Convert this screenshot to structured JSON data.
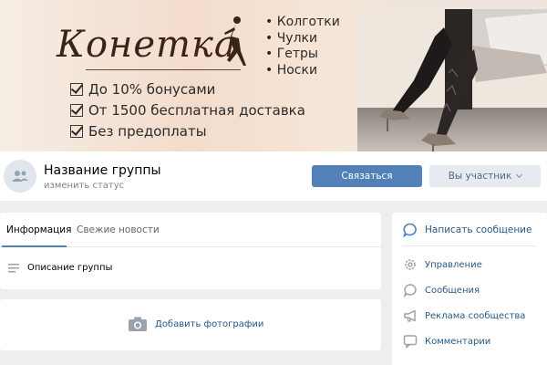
{
  "cover": {
    "logo": "Конетка",
    "features": [
      "• Колготки",
      "• Чулки",
      "• Гетры",
      "• Носки"
    ],
    "perks": [
      "До 10% бонусами",
      "От 1500 бесплатная доставка",
      "Без предоплаты"
    ]
  },
  "header": {
    "group_name": "Название группы",
    "status": "изменить статус",
    "contact_button": "Связаться",
    "member_button": "Вы участник"
  },
  "info_card": {
    "tabs": [
      {
        "label": "Информация",
        "active": true
      },
      {
        "label": "Свежие новости",
        "active": false
      }
    ],
    "description": "Описание группы"
  },
  "photo_card": {
    "add_photo": "Добавить фотографии"
  },
  "menu": {
    "send_message": "Написать сообщение",
    "items": [
      {
        "label": "Управление",
        "icon": "gear-icon"
      },
      {
        "label": "Сообщения",
        "icon": "message-icon"
      },
      {
        "label": "Реклама сообщества",
        "icon": "megaphone-icon"
      },
      {
        "label": "Комментарии",
        "icon": "comment-icon"
      }
    ]
  },
  "colors": {
    "accent": "#5181b8",
    "link": "#2a5885",
    "background": "#edeef0"
  }
}
